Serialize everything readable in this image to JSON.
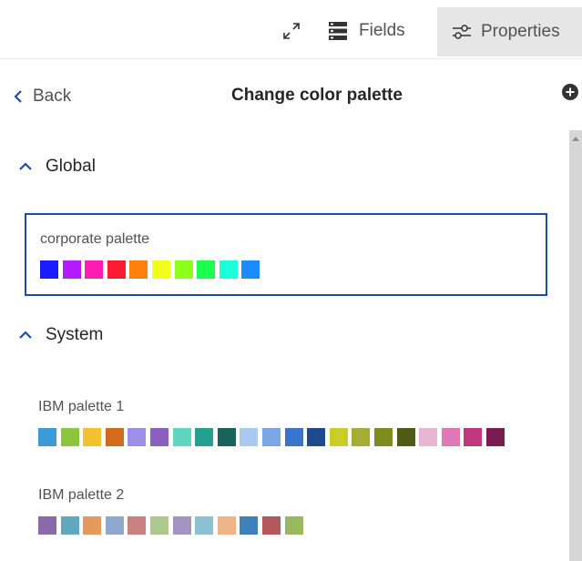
{
  "toolbar": {
    "fields_label": "Fields",
    "properties_label": "Properties"
  },
  "header": {
    "back_label": "Back",
    "title": "Change color palette"
  },
  "sections": {
    "global": "Global",
    "system": "System"
  },
  "palettes": {
    "corporate": {
      "name": "corporate palette",
      "colors": [
        "#1a1aff",
        "#b31aff",
        "#ff1ab3",
        "#ff1a33",
        "#ff7f0e",
        "#f2ff1a",
        "#8cff1a",
        "#1aff4d",
        "#1affd9",
        "#1a8cff"
      ]
    },
    "ibm1": {
      "name": "IBM palette 1",
      "colors": [
        "#3b9bd6",
        "#8cc63f",
        "#f2c12e",
        "#d36b1e",
        "#9b8fe8",
        "#8b5fbf",
        "#5ed6c0",
        "#23a08e",
        "#17625a",
        "#aac9f0",
        "#7ba7e6",
        "#3b74c8",
        "#1c4a8c",
        "#c9cf26",
        "#a6ad32",
        "#7f8a1f",
        "#4f5a14",
        "#e8b5d4",
        "#e078b8",
        "#c2387f",
        "#7a1c4f"
      ]
    },
    "ibm2": {
      "name": "IBM palette 2",
      "colors": [
        "#8a6aa8",
        "#5fa8bf",
        "#e39a5a",
        "#8ea7cf",
        "#c9807f",
        "#aac98a",
        "#a393c2",
        "#8cc0d4",
        "#f0b289",
        "#3f80b8",
        "#b5585c",
        "#9ab860"
      ]
    }
  },
  "icons": {
    "expand": "expand-icon",
    "fields": "fields-icon",
    "properties": "sliders-icon",
    "back": "chevron-left-icon",
    "collapse": "chevron-up-icon",
    "add": "add-circle-icon"
  },
  "colors": {
    "selected_border": "#1f4ba8",
    "accent": "#1f4ba8",
    "toolbar_active_bg": "#e6e6e6"
  }
}
